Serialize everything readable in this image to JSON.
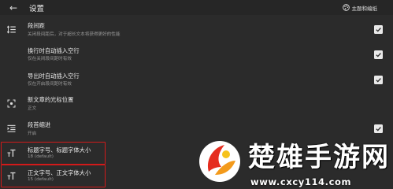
{
  "header": {
    "title": "设置",
    "back_icon": "arrow-left-icon",
    "theme_button_label": "主题和编纸",
    "theme_icon": "palette-icon"
  },
  "settings": [
    {
      "icon": "paragraph-spacing-icon",
      "title": "段间距",
      "subtitle": "关闭段间距后，对于超长文本将获得更好的性能",
      "checked": true
    },
    {
      "icon": "",
      "title": "换行时自动插入空行",
      "subtitle": "仅在关闭段间距时有效",
      "checked": true
    },
    {
      "icon": "",
      "title": "导出时自动插入空行",
      "subtitle": "仅在开启段间距时有效",
      "checked": true
    },
    {
      "icon": "cursor-position-icon",
      "title": "新文章的光标位置",
      "subtitle": "正文"
    },
    {
      "icon": "indent-icon",
      "title": "段首缩进",
      "subtitle": "开启",
      "checked": true
    },
    {
      "icon": "text-size-icon",
      "title": "标题字号、标题字体大小",
      "subtitle": "18 (default)"
    },
    {
      "icon": "text-size-icon",
      "title": "正文字号、正文字体大小",
      "subtitle": "15 (default)"
    }
  ],
  "watermark": {
    "logo": "chuxiong-logo",
    "text": "楚雄手游网",
    "url": "www.cxcy114.com"
  },
  "colors": {
    "background": "#2b2b2b",
    "highlight_box": "#d21a1a",
    "checkbox": "#e9e9e9"
  }
}
